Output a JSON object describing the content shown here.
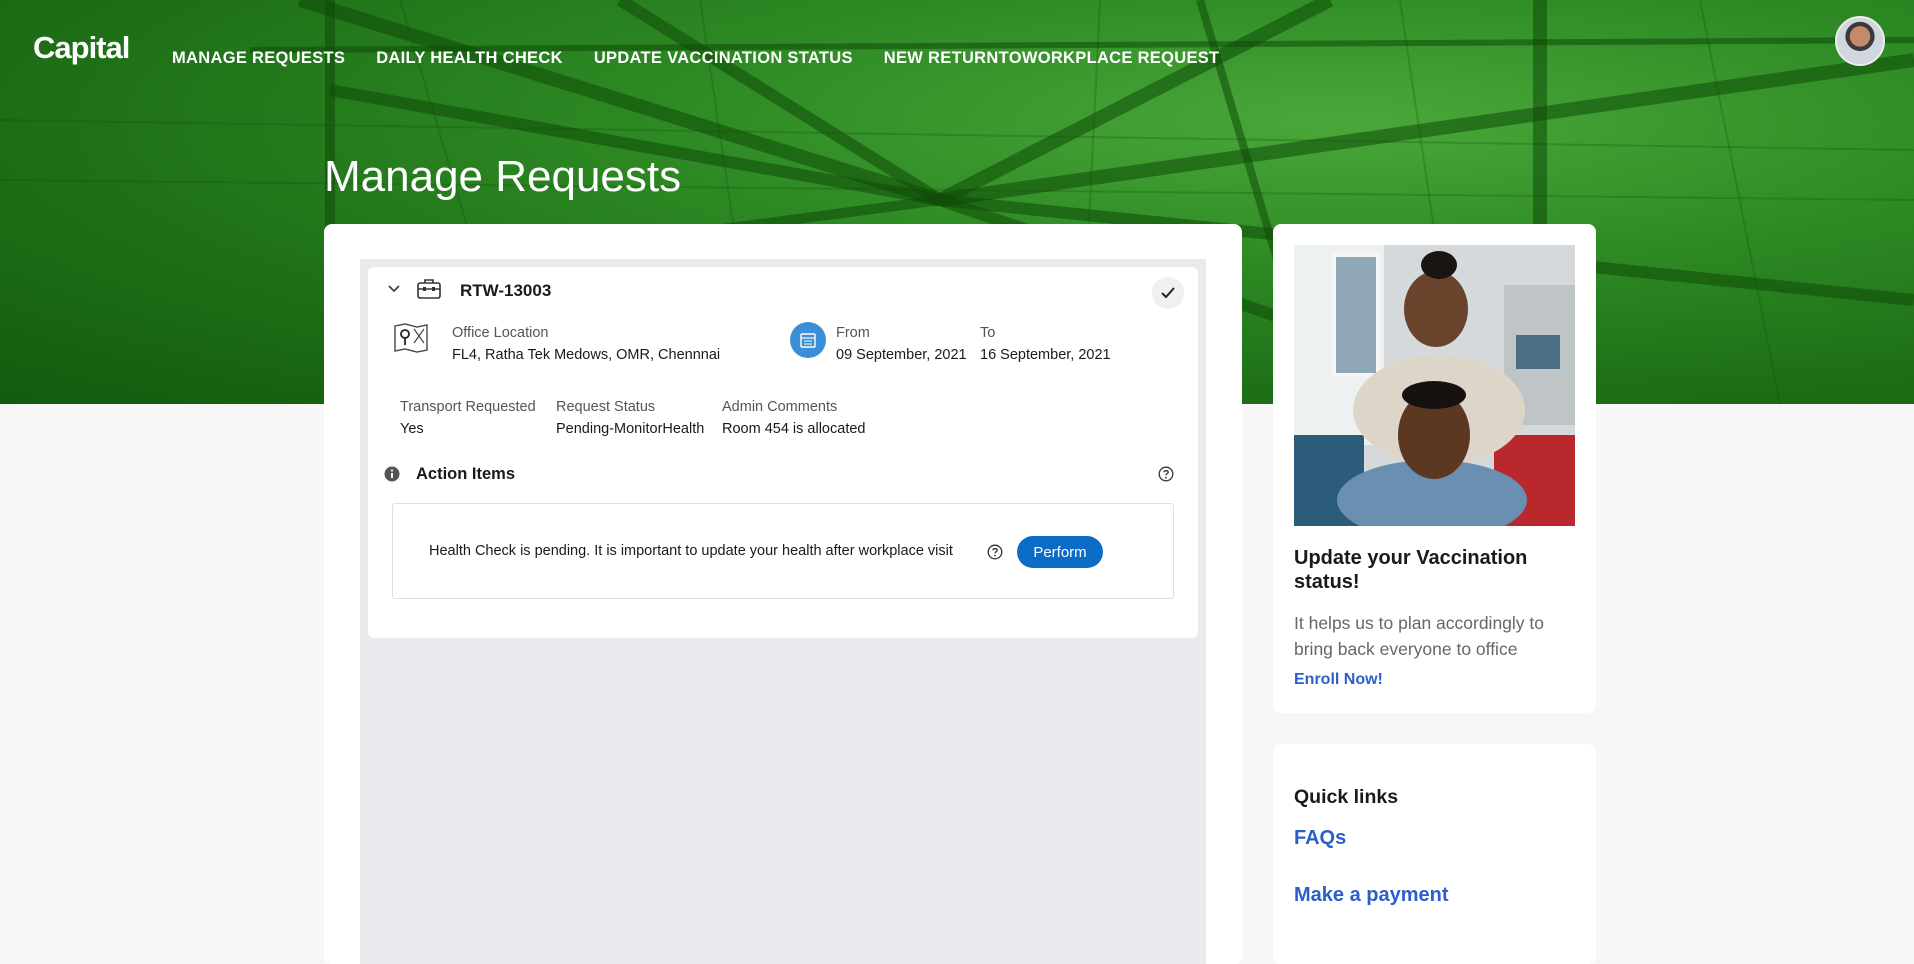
{
  "app": {
    "logo": "Capital"
  },
  "nav": {
    "items": [
      "MANAGE REQUESTS",
      "DAILY HEALTH CHECK",
      "UPDATE VACCINATION STATUS",
      "NEW RETURNTOWORKPLACE REQUEST"
    ]
  },
  "page": {
    "title": "Manage Requests"
  },
  "request": {
    "id": "RTW-13003",
    "office_location_label": "Office Location",
    "office_location": "FL4, Ratha Tek Medows, OMR, Chennnai",
    "from_label": "From",
    "from_date": "09 September, 2021",
    "to_label": "To",
    "to_date": "16 September, 2021",
    "transport_label": "Transport Requested",
    "transport_value": "Yes",
    "status_label": "Request Status",
    "status_value": "Pending-MonitorHealth",
    "admin_label": "Admin Comments",
    "admin_value": "Room 454 is allocated",
    "action_items_label": "Action Items",
    "action_text": "Health Check is pending. It is important to update your health after workplace visit",
    "perform_label": "Perform"
  },
  "promo": {
    "title": "Update your Vaccination status!",
    "text": "It helps us to plan accordingly to bring back everyone to office",
    "link": "Enroll Now!"
  },
  "quick_links": {
    "title": "Quick links",
    "items": [
      "FAQs",
      "Make a payment"
    ]
  },
  "colors": {
    "brand_green": "#2e8a24",
    "primary_blue": "#0b6cc7",
    "link_blue": "#2c5fc8"
  }
}
